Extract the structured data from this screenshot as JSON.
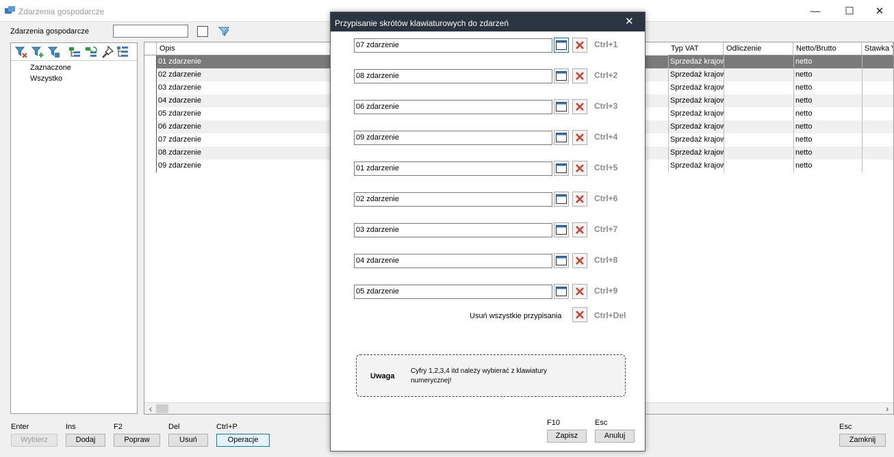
{
  "window": {
    "title": "Zdarzenia gospodarcze",
    "minimize_glyph": "—",
    "maximize_glyph": "☐",
    "close_glyph": "✕"
  },
  "filter": {
    "label": "Zdarzenia gospodarcze",
    "value": ""
  },
  "tree": {
    "items": [
      "Zaznaczone",
      "Wszystko"
    ]
  },
  "grid": {
    "columns": [
      "Opis",
      "Typ VAT",
      "Odliczenie",
      "Netto/Brutto",
      "Stawka V"
    ],
    "rows": [
      {
        "opis": "01 zdarzenie",
        "typ_vat": "Sprzedaż krajow",
        "odliczenie": "",
        "netto": "netto"
      },
      {
        "opis": "02 zdarzenie",
        "typ_vat": "Sprzedaż krajow",
        "odliczenie": "",
        "netto": "netto"
      },
      {
        "opis": "03 zdarzenie",
        "typ_vat": "Sprzedaż krajow",
        "odliczenie": "",
        "netto": "netto"
      },
      {
        "opis": "04 zdarzenie",
        "typ_vat": "Sprzedaż krajow",
        "odliczenie": "",
        "netto": "netto"
      },
      {
        "opis": "05 zdarzenie",
        "typ_vat": "Sprzedaż krajow",
        "odliczenie": "",
        "netto": "netto"
      },
      {
        "opis": "06 zdarzenie",
        "typ_vat": "Sprzedaż krajow",
        "odliczenie": "",
        "netto": "netto"
      },
      {
        "opis": "07 zdarzenie",
        "typ_vat": "Sprzedaż krajow",
        "odliczenie": "",
        "netto": "netto"
      },
      {
        "opis": "08 zdarzenie",
        "typ_vat": "Sprzedaż krajow",
        "odliczenie": "",
        "netto": "netto"
      },
      {
        "opis": "09 zdarzenie",
        "typ_vat": "Sprzedaż krajow",
        "odliczenie": "",
        "netto": "netto"
      }
    ],
    "scroll_left": "‹",
    "scroll_right": "›"
  },
  "bottom": {
    "keys": {
      "enter": "Enter",
      "ins": "Ins",
      "f2": "F2",
      "del": "Del",
      "ctrlp": "Ctrl+P",
      "esc": "Esc"
    },
    "buttons": {
      "wybierz": "Wybierz",
      "dodaj": "Dodaj",
      "popraw": "Popraw",
      "usun": "Usuń",
      "operacje": "Operacje",
      "zamknij": "Zamknij"
    }
  },
  "dialog": {
    "title": "Przypisanie skrótów klawiaturowych do zdarzeń",
    "close_glyph": "✕",
    "assignments": [
      {
        "value": "07 zdarzenie",
        "shortcut": "Ctrl+1"
      },
      {
        "value": "08 zdarzenie",
        "shortcut": "Ctrl+2"
      },
      {
        "value": "06 zdarzenie",
        "shortcut": "Ctrl+3"
      },
      {
        "value": "09 zdarzenie",
        "shortcut": "Ctrl+4"
      },
      {
        "value": "01 zdarzenie",
        "shortcut": "Ctrl+5"
      },
      {
        "value": "02 zdarzenie",
        "shortcut": "Ctrl+6"
      },
      {
        "value": "03 zdarzenie",
        "shortcut": "Ctrl+7"
      },
      {
        "value": "04 zdarzenie",
        "shortcut": "Ctrl+8"
      },
      {
        "value": "05 zdarzenie",
        "shortcut": "Ctrl+9"
      }
    ],
    "remove_all_label": "Usuń wszystkie przypisania",
    "remove_all_shortcut": "Ctrl+Del",
    "note_title": "Uwaga",
    "note_text": "Cyfry 1,2,3,4 itd należy wybierać z klawiatury numerycznej!",
    "save_key": "F10",
    "cancel_key": "Esc",
    "save_label": "Zapisz",
    "cancel_label": "Anuluj"
  },
  "colors": {
    "dialog_header": "#2b3441",
    "selected_row": "#7a7a7a",
    "x_red": "#d0402a",
    "accent_blue": "#2a6fb0"
  }
}
